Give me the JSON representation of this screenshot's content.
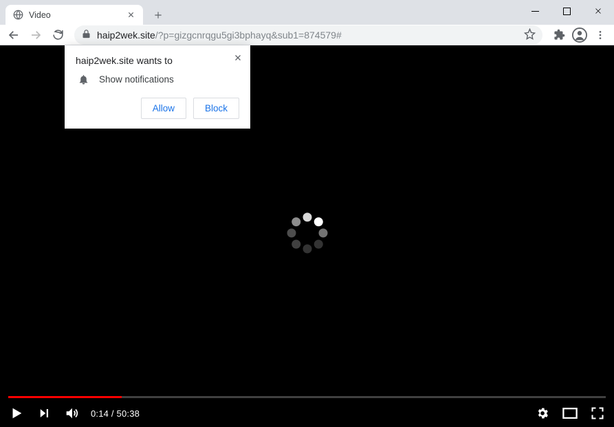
{
  "tab": {
    "title": "Video"
  },
  "url": {
    "domain": "haip2wek.site",
    "path": "/?p=gizgcnrqgu5gi3bphayq&sub1=874579#"
  },
  "permission": {
    "title": "haip2wek.site wants to",
    "message": "Show notifications",
    "allow": "Allow",
    "block": "Block"
  },
  "player": {
    "elapsed": "0:14",
    "separator": " / ",
    "duration": "50:38",
    "progress_percent": 19
  },
  "spinner_dots": [
    {
      "angle": -90,
      "opacity": 0.85
    },
    {
      "angle": -45,
      "opacity": 1.0
    },
    {
      "angle": 0,
      "opacity": 0.45
    },
    {
      "angle": 45,
      "opacity": 0.2
    },
    {
      "angle": 90,
      "opacity": 0.2
    },
    {
      "angle": 135,
      "opacity": 0.25
    },
    {
      "angle": 180,
      "opacity": 0.3
    },
    {
      "angle": 225,
      "opacity": 0.55
    }
  ]
}
